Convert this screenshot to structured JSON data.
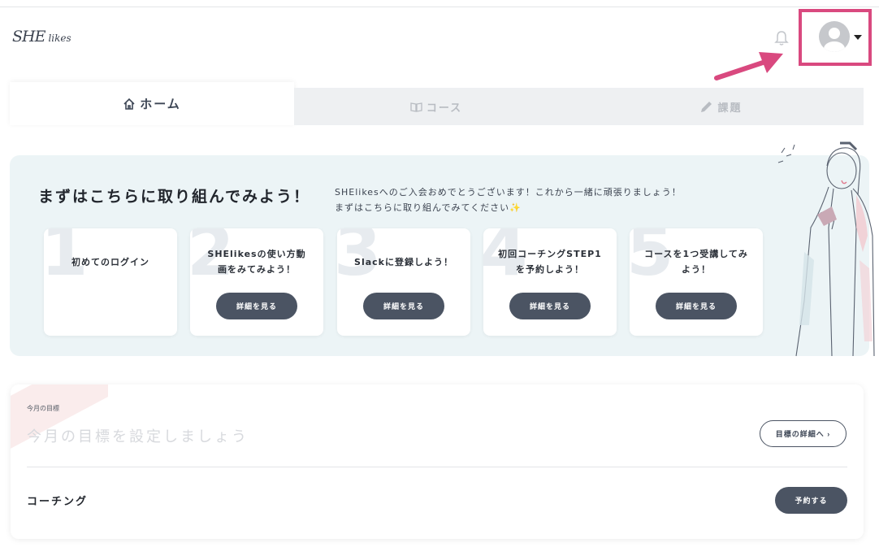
{
  "header": {
    "logo_main": "SHE",
    "logo_sub": "likes",
    "icons": [
      "bell-icon",
      "avatar-icon",
      "caret-down-icon"
    ],
    "highlight_color": "#d9497f"
  },
  "tabs": [
    {
      "label": "ホーム",
      "icon": "home-icon",
      "active": true
    },
    {
      "label": "コース",
      "icon": "book-icon",
      "active": false
    },
    {
      "label": "課題",
      "icon": "pencil-icon",
      "active": false
    }
  ],
  "onboarding": {
    "title": "まずはこちらに取り組んでみよう！",
    "message_line1": "SHElikesへのご入会おめでとうございます！これから一緒に頑張りましょう！",
    "message_line2": "まずはこちらに取り組んでみてください✨",
    "steps": [
      {
        "number": "1",
        "line1": "初めてのログイン",
        "line2": "",
        "button": ""
      },
      {
        "number": "2",
        "line1": "SHElikesの使い方動",
        "line2": "画をみてみよう！",
        "button": "詳細を見る"
      },
      {
        "number": "3",
        "line1": "Slackに登録しよう！",
        "line2": "",
        "button": "詳細を見る"
      },
      {
        "number": "4",
        "line1": "初回コーチングSTEP1",
        "line2": "を予約しよう！",
        "button": "詳細を見る"
      },
      {
        "number": "5",
        "line1": "コースを1つ受講してみ",
        "line2": "よう！",
        "button": "詳細を見る"
      }
    ]
  },
  "goal": {
    "label": "今月の目標",
    "placeholder": "今月の目標を設定しましょう",
    "button": "目標の詳細へ ›"
  },
  "coaching": {
    "label": "コーチング",
    "button": "予約する"
  },
  "colors": {
    "button_dark": "#4b5463",
    "onboarding_bg": "#ecf4f6"
  }
}
